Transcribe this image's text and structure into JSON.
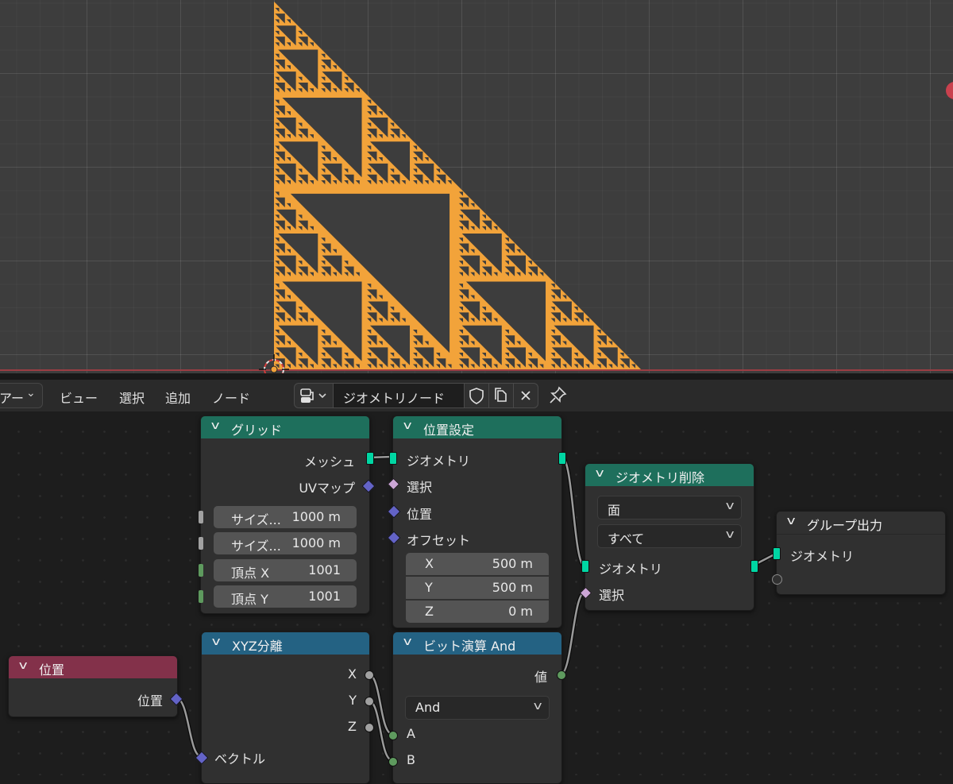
{
  "viewport": {
    "fractal": "sierpinski-triangle",
    "colors": {
      "background": "#3d3d3d",
      "mesh": "#f2a33a",
      "x_axis": "#9b3d43"
    }
  },
  "header": {
    "editor_type_label": "アー",
    "menus": [
      "ビュー",
      "選択",
      "追加",
      "ノード"
    ],
    "node_tree_name": "ジオメトリノード"
  },
  "nodes": {
    "grid": {
      "title": "グリッド",
      "outputs": [
        "メッシュ",
        "UVマップ"
      ],
      "fields": [
        {
          "label": "サイズ...",
          "value": "1000 m"
        },
        {
          "label": "サイズ...",
          "value": "1000 m"
        },
        {
          "label": "頂点 X",
          "value": "1001"
        },
        {
          "label": "頂点 Y",
          "value": "1001"
        }
      ]
    },
    "set_position": {
      "title": "位置設定",
      "output": "ジオメトリ",
      "inputs": [
        "ジオメトリ",
        "選択",
        "位置",
        "オフセット"
      ],
      "offset": [
        {
          "axis": "X",
          "value": "500 m"
        },
        {
          "axis": "Y",
          "value": "500 m"
        },
        {
          "axis": "Z",
          "value": "0 m"
        }
      ]
    },
    "delete_geometry": {
      "title": "ジオメトリ削除",
      "domain": "面",
      "mode": "すべて",
      "inputs": [
        "ジオメトリ",
        "選択"
      ]
    },
    "group_output": {
      "title": "グループ出力",
      "inputs": [
        "ジオメトリ"
      ]
    },
    "position": {
      "title": "位置",
      "output": "位置"
    },
    "separate_xyz": {
      "title": "XYZ分離",
      "outputs": [
        "X",
        "Y",
        "Z"
      ],
      "input": "ベクトル"
    },
    "bitwise_and": {
      "title": "ビット演算 And",
      "output": "値",
      "operation": "And",
      "inputs": [
        "A",
        "B"
      ]
    }
  },
  "colors": {
    "geometry_header": "#1e6f5c",
    "input_header": "#83314a",
    "converter_header": "#246283",
    "geometry_socket": "#00d6a3",
    "vector_socket": "#6363c7",
    "boolean_socket": "#cca6d6",
    "integer_socket": "#5e9a5e"
  }
}
